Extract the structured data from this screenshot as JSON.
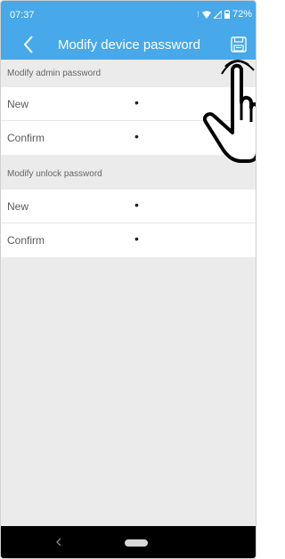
{
  "status_bar": {
    "time": "07:37",
    "battery": "72%",
    "icons": [
      "alarm-icon",
      "wifi-icon",
      "signal-icon",
      "battery-icon"
    ]
  },
  "header": {
    "title": "Modify device password",
    "back_icon": "chevron-left-icon",
    "save_icon": "save-icon",
    "background": "#47a8ea"
  },
  "sections": [
    {
      "header": "Modify admin password",
      "fields": [
        {
          "label": "New",
          "value": "•"
        },
        {
          "label": "Confirm",
          "value": "•"
        }
      ]
    },
    {
      "header": "Modify unlock password",
      "fields": [
        {
          "label": "New",
          "value": "•"
        },
        {
          "label": "Confirm",
          "value": "•"
        }
      ]
    }
  ],
  "nav_bar": {
    "back_icon": "nav-back-icon",
    "home_icon": "home-pill-icon"
  },
  "overlay": {
    "icon": "pointing-hand-icon"
  }
}
